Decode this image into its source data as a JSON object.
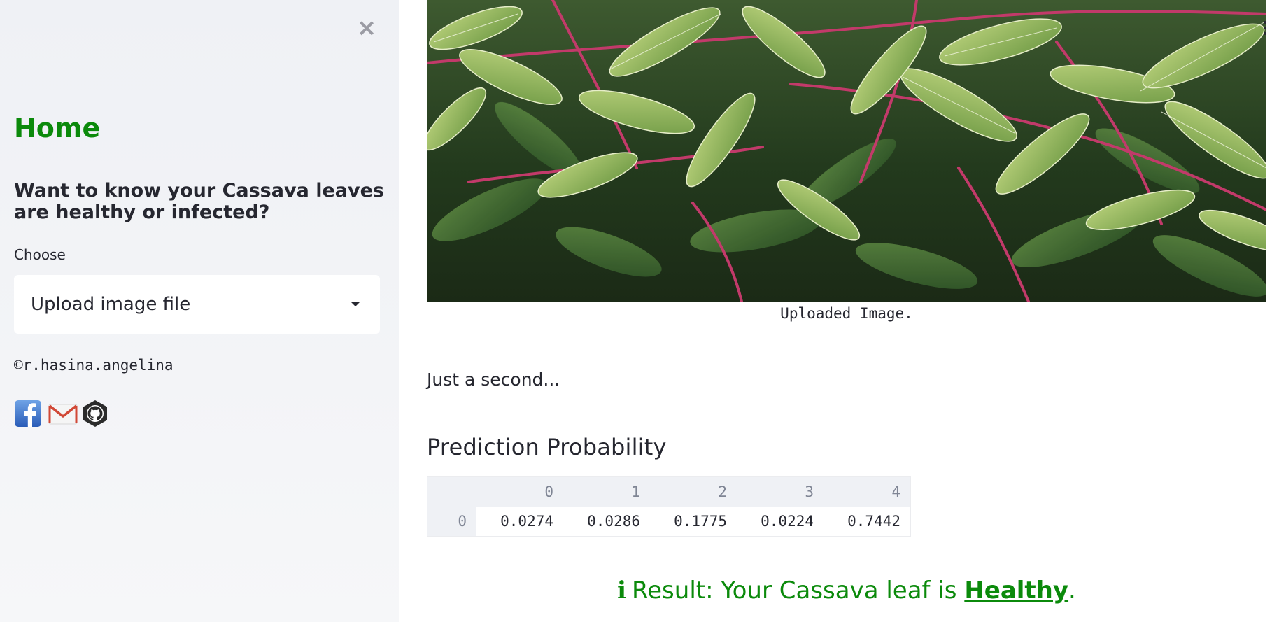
{
  "sidebar": {
    "close_symbol": "×",
    "home_title": "Home",
    "question": "Want to know your Cassava leaves are healthy or infected?",
    "choose_label": "Choose",
    "select_value": "Upload image file",
    "copyright": "©r.hasina.angelina",
    "social_icons": [
      "facebook-icon",
      "gmail-icon",
      "github-icon"
    ]
  },
  "main": {
    "image_caption": "Uploaded Image.",
    "wait_text": "Just a second...",
    "prediction_heading": "Prediction Probability",
    "table": {
      "columns": [
        "0",
        "1",
        "2",
        "3",
        "4"
      ],
      "rows": [
        {
          "index": "0",
          "values": [
            "0.0274",
            "0.0286",
            "0.1775",
            "0.0224",
            "0.7442"
          ]
        }
      ]
    },
    "result": {
      "icon": "ℹ",
      "prefix": "Result: Your Cassava leaf is ",
      "label": "Healthy",
      "suffix": "."
    }
  },
  "colors": {
    "accent_green": "#0b8a0b",
    "sidebar_bg": "#eff1f5",
    "text": "#262730",
    "table_header_text": "#7f8594"
  }
}
